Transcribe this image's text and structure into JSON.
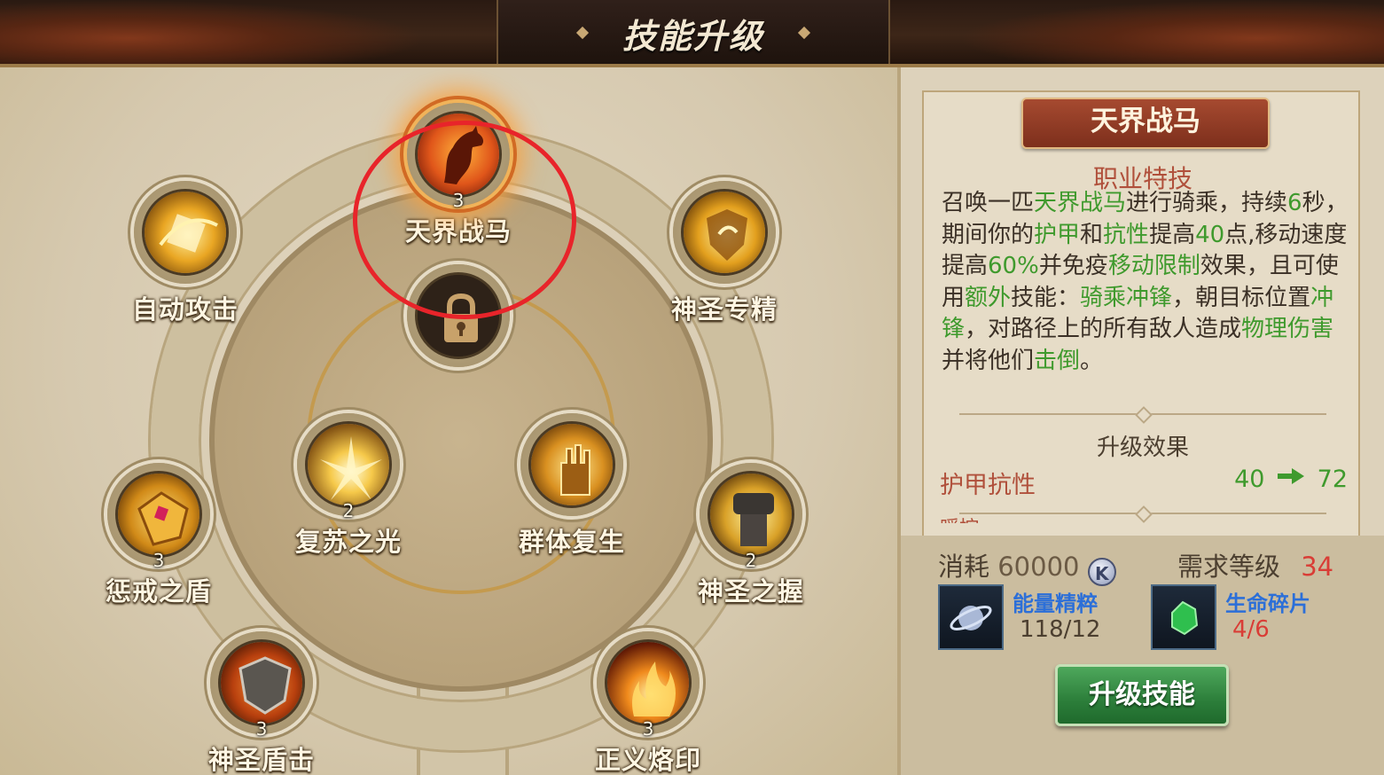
{
  "window": {
    "title": "技能升级"
  },
  "skills": {
    "celestial_steed": {
      "name": "天界战马",
      "level": "3"
    },
    "auto_attack": {
      "name": "自动攻击"
    },
    "holy_mastery": {
      "name": "神圣专精"
    },
    "revive_light": {
      "name": "复苏之光",
      "level": "2"
    },
    "mass_resurrection": {
      "name": "群体复生"
    },
    "punish_shield": {
      "name": "惩戒之盾",
      "level": "3"
    },
    "holy_grip": {
      "name": "神圣之握",
      "level": "2"
    },
    "holy_shield_bash": {
      "name": "神圣盾击",
      "level": "3"
    },
    "justice_brand": {
      "name": "正义烙印",
      "level": "3"
    }
  },
  "detail": {
    "skill_name": "天界战马",
    "category": "职业特技",
    "description": [
      {
        "t": "召唤一匹",
        "g": false
      },
      {
        "t": "天界战马",
        "g": true
      },
      {
        "t": "进行骑乘，持续",
        "g": false
      },
      {
        "t": "6",
        "g": true
      },
      {
        "t": "秒，期间你的",
        "g": false
      },
      {
        "t": "护甲",
        "g": true
      },
      {
        "t": "和",
        "g": false
      },
      {
        "t": "抗性",
        "g": true
      },
      {
        "t": "提高",
        "g": false
      },
      {
        "t": "40",
        "g": true
      },
      {
        "t": "点,移动速度提高",
        "g": false
      },
      {
        "t": "60%",
        "g": true
      },
      {
        "t": "并免疫",
        "g": false
      },
      {
        "t": "移动限制",
        "g": true
      },
      {
        "t": "效果，且可使用",
        "g": false
      },
      {
        "t": "额外",
        "g": true
      },
      {
        "t": "技能：",
        "g": false
      },
      {
        "t": "骑乘冲锋",
        "g": true
      },
      {
        "t": "，朝目标位置",
        "g": false
      },
      {
        "t": "冲锋",
        "g": true
      },
      {
        "t": "，对路径上的所有敌人造成",
        "g": false
      },
      {
        "t": "物理伤害",
        "g": true
      },
      {
        "t": "并将他们",
        "g": false
      },
      {
        "t": "击倒",
        "g": true
      },
      {
        "t": "。",
        "g": false
      }
    ],
    "upgrade_title": "升级效果",
    "effect": {
      "label": "护甲抗性",
      "from": "40",
      "to": "72"
    },
    "cutoff_text": "暖控"
  },
  "cost": {
    "label": "消耗",
    "amount": "60000",
    "currency_symbol": "K",
    "req_label": "需求等级",
    "req_level": "34"
  },
  "materials": [
    {
      "name": "能量精粹",
      "count": "118/12"
    },
    {
      "name": "生命碎片",
      "count": "4/6"
    }
  ],
  "actions": {
    "upgrade": "升级技能"
  },
  "colors": {
    "highlight_green": "#3f9a2d",
    "warn_red": "#d93d36",
    "material_blue": "#2c6fd8",
    "annotation_circle": "#e8242a"
  }
}
